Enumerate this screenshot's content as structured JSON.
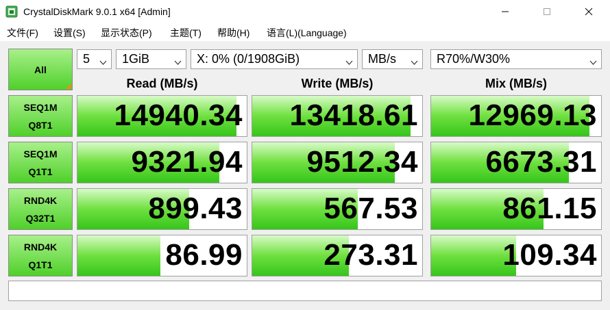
{
  "window": {
    "title": "CrystalDiskMark 9.0.1 x64 [Admin]"
  },
  "menu": [
    {
      "label": "文件(F)"
    },
    {
      "label": "设置(S)"
    },
    {
      "label": "显示状态(P)"
    },
    {
      "label": "主题(T)"
    },
    {
      "label": "帮助(H)"
    },
    {
      "label": "语言(L)(Language)"
    }
  ],
  "controls": {
    "all_label": "All",
    "count": "5",
    "size": "1GiB",
    "drive": "X: 0% (0/1908GiB)",
    "unit": "MB/s",
    "mix": "R70%/W30%"
  },
  "headers": {
    "read": "Read (MB/s)",
    "write": "Write (MB/s)",
    "mix": "Mix (MB/s)"
  },
  "rows": [
    {
      "label1": "SEQ1M",
      "label2": "Q8T1",
      "read": "14940.34",
      "write": "13418.61",
      "mix": "12969.13",
      "read_fill": 0.94,
      "write_fill": 0.93,
      "mix_fill": 0.93
    },
    {
      "label1": "SEQ1M",
      "label2": "Q1T1",
      "read": "9321.94",
      "write": "9512.34",
      "mix": "6673.31",
      "read_fill": 0.84,
      "write_fill": 0.84,
      "mix_fill": 0.81
    },
    {
      "label1": "RND4K",
      "label2": "Q32T1",
      "read": "899.43",
      "write": "567.53",
      "mix": "861.15",
      "read_fill": 0.66,
      "write_fill": 0.62,
      "mix_fill": 0.66
    },
    {
      "label1": "RND4K",
      "label2": "Q1T1",
      "read": "86.99",
      "write": "273.31",
      "mix": "109.34",
      "read_fill": 0.49,
      "write_fill": 0.57,
      "mix_fill": 0.5
    }
  ],
  "colors": {
    "accent_green": "#4fd02a",
    "corner_orange": "#f08a1c"
  }
}
